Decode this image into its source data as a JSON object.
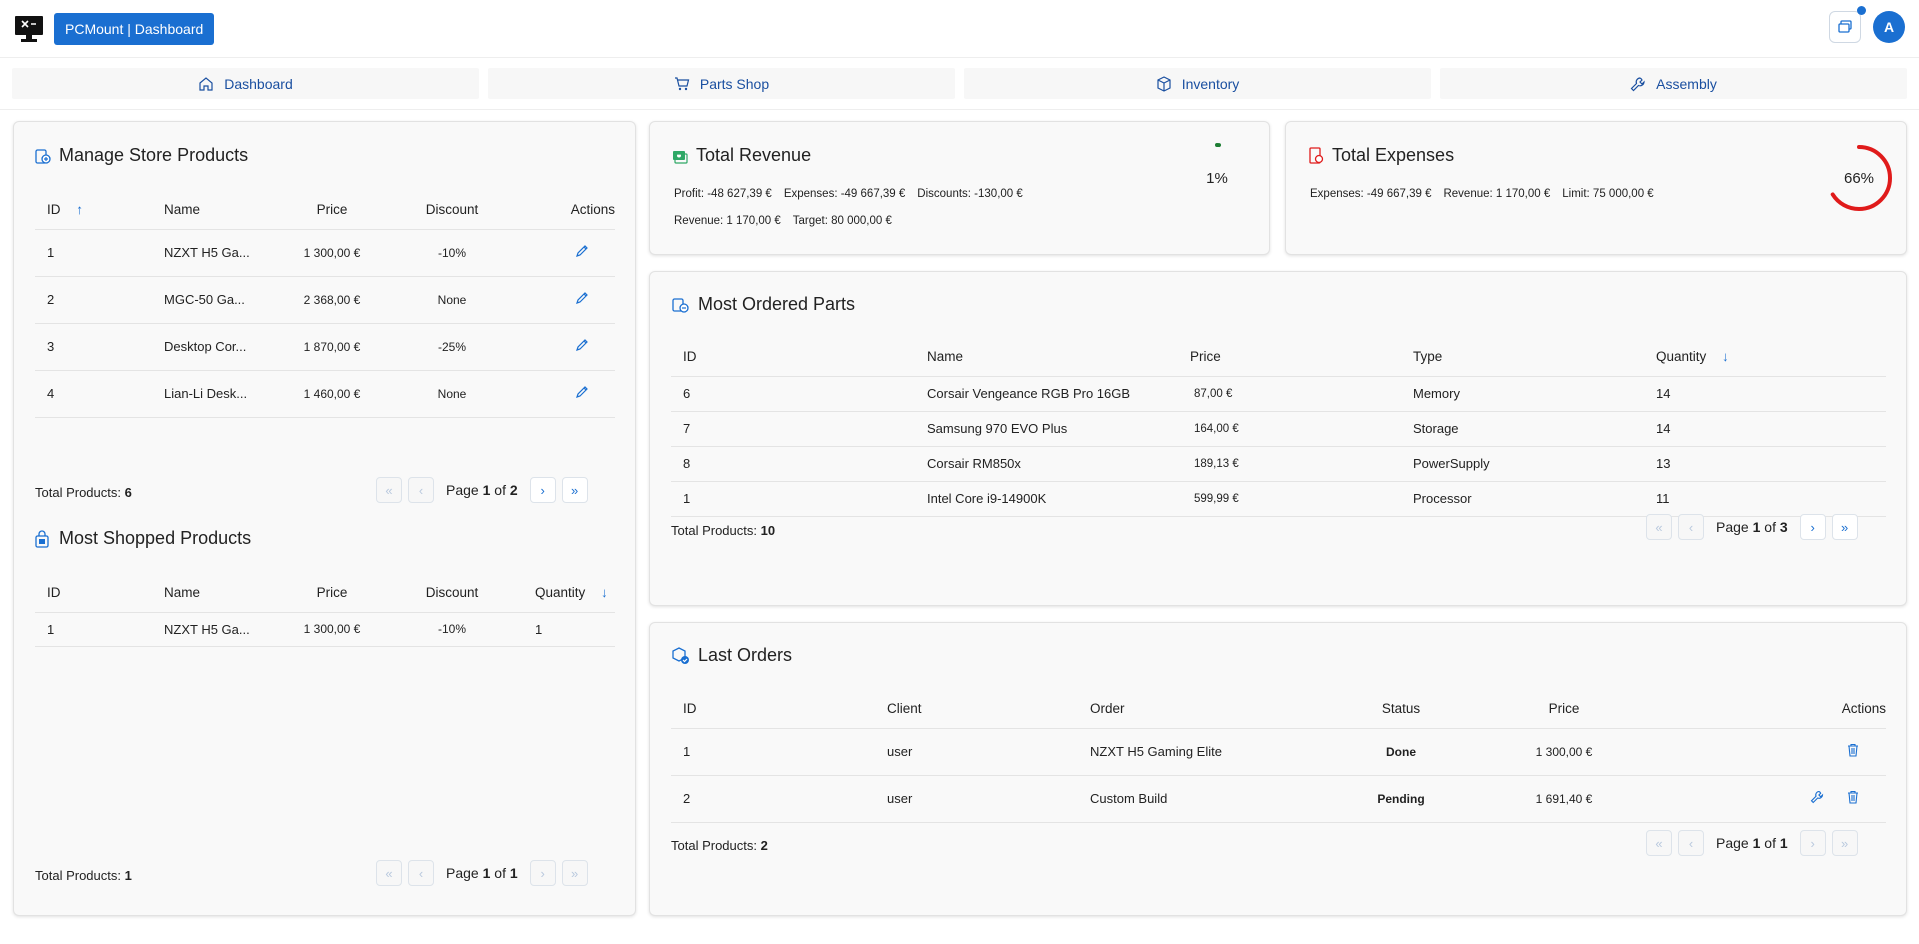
{
  "header": {
    "brand": "PCMount | Dashboard",
    "avatar_letter": "A"
  },
  "nav": [
    {
      "label": "Dashboard",
      "icon": "home-icon"
    },
    {
      "label": "Parts Shop",
      "icon": "cart-icon"
    },
    {
      "label": "Inventory",
      "icon": "box-icon"
    },
    {
      "label": "Assembly",
      "icon": "wrench-icon"
    }
  ],
  "manage_store": {
    "title": "Manage Store Products",
    "headers": [
      "ID",
      "Name",
      "Price",
      "Discount",
      "Actions"
    ],
    "rows": [
      {
        "id": "1",
        "name": "NZXT H5 Ga...",
        "price": "1 300,00 €",
        "discount": "-10%"
      },
      {
        "id": "2",
        "name": "MGC-50 Ga...",
        "price": "2 368,00 €",
        "discount": "None"
      },
      {
        "id": "3",
        "name": "Desktop Cor...",
        "price": "1 870,00 €",
        "discount": "-25%"
      },
      {
        "id": "4",
        "name": "Lian-Li Desk...",
        "price": "1 460,00 €",
        "discount": "None"
      }
    ],
    "total_label": "Total Products:",
    "total": "6",
    "page_label": "Page",
    "page": "1",
    "of": "of",
    "pages": "2"
  },
  "most_shopped": {
    "title": "Most Shopped Products",
    "headers": [
      "ID",
      "Name",
      "Price",
      "Discount",
      "Quantity"
    ],
    "rows": [
      {
        "id": "1",
        "name": "NZXT H5 Ga...",
        "price": "1 300,00 €",
        "discount": "-10%",
        "qty": "1"
      }
    ],
    "total_label": "Total Products:",
    "total": "1",
    "page_label": "Page",
    "page": "1",
    "of": "of",
    "pages": "1"
  },
  "revenue": {
    "title": "Total Revenue",
    "profit": "Profit: -48 627,39 €",
    "expenses": "Expenses: -49 667,39 €",
    "discounts": "Discounts: -130,00 €",
    "revenue": "Revenue: 1 170,00 €",
    "target": "Target: 80 000,00 €",
    "percent": "1%",
    "progress": 0.01,
    "color": "#1e7e34"
  },
  "expenses": {
    "title": "Total Expenses",
    "expenses": "Expenses: -49 667,39 €",
    "revenue": "Revenue: 1 170,00 €",
    "limit": "Limit: 75 000,00 €",
    "percent": "66%",
    "progress": 0.66,
    "color": "#e01b1b"
  },
  "most_ordered": {
    "title": "Most Ordered Parts",
    "headers": [
      "ID",
      "Name",
      "Price",
      "Type",
      "Quantity"
    ],
    "rows": [
      {
        "id": "6",
        "name": "Corsair Vengeance RGB Pro 16GB",
        "price": "87,00 €",
        "type": "Memory",
        "qty": "14"
      },
      {
        "id": "7",
        "name": "Samsung 970 EVO Plus",
        "price": "164,00 €",
        "type": "Storage",
        "qty": "14"
      },
      {
        "id": "8",
        "name": "Corsair RM850x",
        "price": "189,13 €",
        "type": "PowerSupply",
        "qty": "13"
      },
      {
        "id": "1",
        "name": "Intel Core i9-14900K",
        "price": "599,99 €",
        "type": "Processor",
        "qty": "11"
      }
    ],
    "total_label": "Total Products:",
    "total": "10",
    "page_label": "Page",
    "page": "1",
    "of": "of",
    "pages": "3"
  },
  "last_orders": {
    "title": "Last Orders",
    "headers": [
      "ID",
      "Client",
      "Order",
      "Status",
      "Price",
      "Actions"
    ],
    "rows": [
      {
        "id": "1",
        "client": "user",
        "order": "NZXT H5 Gaming Elite",
        "status": "Done",
        "price": "1 300,00 €"
      },
      {
        "id": "2",
        "client": "user",
        "order": "Custom Build",
        "status": "Pending",
        "price": "1 691,40 €"
      }
    ],
    "total_label": "Total Products:",
    "total": "2",
    "page_label": "Page",
    "page": "1",
    "of": "of",
    "pages": "1"
  }
}
